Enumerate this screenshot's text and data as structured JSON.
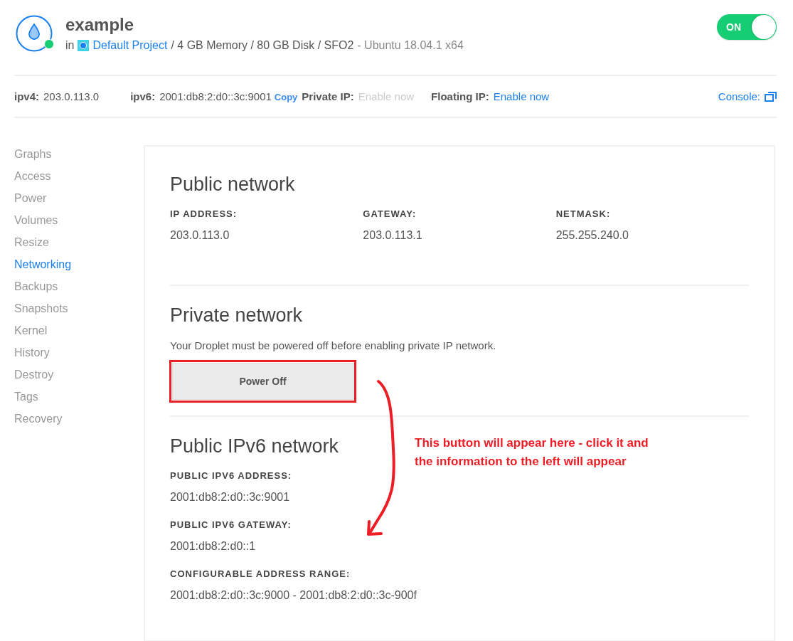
{
  "droplet": {
    "name": "example",
    "online": true,
    "prefix": "in",
    "project": "Default Project",
    "specs": "/ 4 GB Memory / 80 GB Disk / SFO2",
    "image": "- Ubuntu 18.04.1 x64"
  },
  "power_toggle": {
    "label": "ON",
    "on": true
  },
  "info_bar": {
    "ipv4_label": "ipv4:",
    "ipv4": "203.0.113.0",
    "ipv6_label": "ipv6:",
    "ipv6": "2001:db8:2:d0::3c:9001",
    "copy": "Copy",
    "private_label": "Private IP:",
    "private_action": "Enable now",
    "private_disabled": true,
    "floating_label": "Floating IP:",
    "floating_action": "Enable now",
    "floating_disabled": false,
    "console": "Console:"
  },
  "sidebar": {
    "items": [
      {
        "label": "Graphs",
        "selected": false
      },
      {
        "label": "Access",
        "selected": false
      },
      {
        "label": "Power",
        "selected": false
      },
      {
        "label": "Volumes",
        "selected": false
      },
      {
        "label": "Resize",
        "selected": false
      },
      {
        "label": "Networking",
        "selected": true
      },
      {
        "label": "Backups",
        "selected": false
      },
      {
        "label": "Snapshots",
        "selected": false
      },
      {
        "label": "Kernel",
        "selected": false
      },
      {
        "label": "History",
        "selected": false
      },
      {
        "label": "Destroy",
        "selected": false
      },
      {
        "label": "Tags",
        "selected": false
      },
      {
        "label": "Recovery",
        "selected": false
      }
    ]
  },
  "sections": [
    {
      "kind": "columns",
      "title": "Public network",
      "fields": [
        {
          "label": "IP ADDRESS:",
          "value": "203.0.113.0"
        },
        {
          "label": "GATEWAY:",
          "value": "203.0.113.1"
        },
        {
          "label": "NETMASK:",
          "value": "255.255.240.0"
        }
      ]
    },
    {
      "kind": "action",
      "title": "Private network",
      "text": "Your Droplet must be powered off before enabling private IP network.",
      "button": "Power Off",
      "highlighted": true
    },
    {
      "kind": "stacked",
      "title": "Public IPv6 network",
      "fields": [
        {
          "label": "PUBLIC IPV6 ADDRESS:",
          "value": "2001:db8:2:d0::3c:9001"
        },
        {
          "label": "PUBLIC IPV6 GATEWAY:",
          "value": "2001:db8:2:d0::1"
        },
        {
          "label": "CONFIGURABLE ADDRESS RANGE:",
          "value": "2001:db8:2:d0::3c:9000 - 2001:db8:2:d0::3c-900f"
        }
      ]
    }
  ],
  "annotation": {
    "text": "This button will appear here - click it and the information to the left will appear"
  }
}
